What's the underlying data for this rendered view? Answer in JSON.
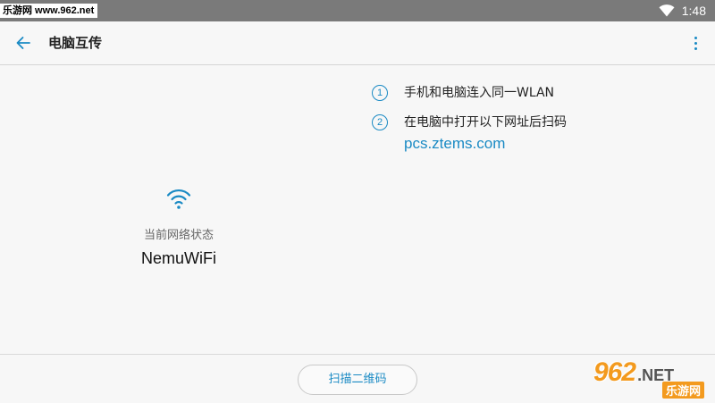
{
  "status_bar": {
    "watermark": "乐游网 www.962.net",
    "time": "1:48",
    "wifi_icon": "wifi-icon"
  },
  "app_bar": {
    "title": "电脑互传",
    "back_icon": "arrow-back-icon",
    "menu_icon": "more-vert-icon"
  },
  "network": {
    "icon": "wifi-icon",
    "label": "当前网络状态",
    "name": "NemuWiFi"
  },
  "steps": [
    {
      "number": "1",
      "text": "手机和电脑连入同一WLAN"
    },
    {
      "number": "2",
      "text": "在电脑中打开以下网址后扫码",
      "url": "pcs.ztems.com"
    }
  ],
  "bottom": {
    "scan_button": "扫描二维码"
  },
  "watermark_logo": {
    "numbers": "962",
    "suffix": ".NET",
    "cn": "乐游网"
  },
  "colors": {
    "accent": "#1a8ac4",
    "status_bar": "#7a7a7a",
    "background": "#f7f7f7"
  }
}
